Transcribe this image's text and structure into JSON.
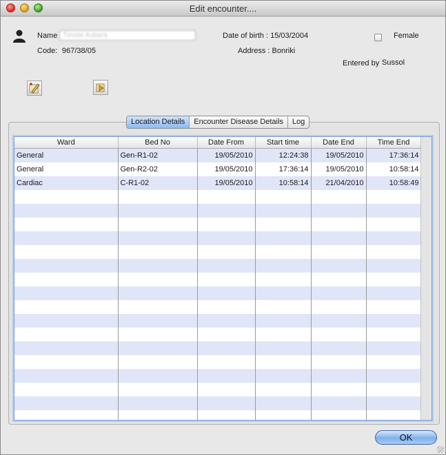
{
  "window": {
    "title": "Edit encounter...."
  },
  "patient": {
    "name_label": "Name",
    "name_value": "Timote Aubara",
    "code_label": "Code:",
    "code_value": "967/38/05",
    "dob_text": "Date of birth : 15/03/2004",
    "address_text": "Address : Bonriki",
    "female_label": "Female",
    "female_checked": false,
    "entered_by_label": "Entered by",
    "entered_by_value": "Sussol"
  },
  "tabs": [
    {
      "label": "Location Details",
      "active": true
    },
    {
      "label": "Encounter Disease Details",
      "active": false
    },
    {
      "label": "Log",
      "active": false
    }
  ],
  "table": {
    "columns": [
      "Ward",
      "Bed No",
      "Date From",
      "Start time",
      "Date End",
      "Time End"
    ],
    "rows": [
      [
        "General",
        "Gen-R1-02",
        "19/05/2010",
        "12:24:38",
        "19/05/2010",
        "17:36:14"
      ],
      [
        "General",
        "Gen-R2-02",
        "19/05/2010",
        "17:36:14",
        "19/05/2010",
        "10:58:14"
      ],
      [
        "Cardiac",
        "C-R1-02",
        "19/05/2010",
        "10:58:14",
        "21/04/2010",
        "10:58:49"
      ]
    ]
  },
  "buttons": {
    "ok_label": "OK"
  },
  "colors": {
    "stripe": "#e0e6f8",
    "selected_tab": "#8dbaf0",
    "table_border": "#7b9ed6"
  }
}
